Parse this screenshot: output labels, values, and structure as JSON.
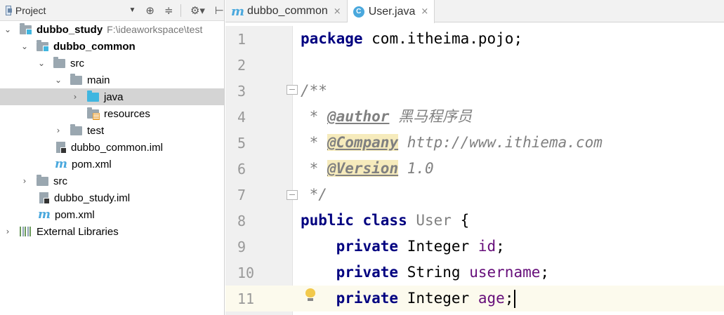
{
  "project_panel": {
    "title": "Project",
    "dropdown": "▼",
    "tools": [
      "⊕",
      "≑",
      "⚙▾",
      "⊢"
    ],
    "tree": [
      {
        "label": "dubbo_study",
        "path": "F:\\ideaworkspace\\test",
        "arrow": "⌄",
        "icon": "module-folder",
        "bold": true
      },
      {
        "label": "dubbo_common",
        "arrow": "⌄",
        "icon": "module-folder",
        "bold": true
      },
      {
        "label": "src",
        "arrow": "⌄",
        "icon": "folder"
      },
      {
        "label": "main",
        "arrow": "⌄",
        "icon": "folder"
      },
      {
        "label": "java",
        "arrow": "›",
        "icon": "source-folder",
        "selected": true
      },
      {
        "label": "resources",
        "arrow": "",
        "icon": "resources-folder"
      },
      {
        "label": "test",
        "arrow": "›",
        "icon": "folder"
      },
      {
        "label": "dubbo_common.iml",
        "arrow": "",
        "icon": "iml-file"
      },
      {
        "label": "pom.xml",
        "arrow": "",
        "icon": "maven-file"
      },
      {
        "label": "src",
        "arrow": "›",
        "icon": "folder"
      },
      {
        "label": "dubbo_study.iml",
        "arrow": "",
        "icon": "iml-file"
      },
      {
        "label": "pom.xml",
        "arrow": "",
        "icon": "maven-file"
      },
      {
        "label": "External Libraries",
        "arrow": "›",
        "icon": "libraries"
      }
    ]
  },
  "editor": {
    "tabs": [
      {
        "label": "dubbo_common",
        "icon": "maven-file",
        "close": "×",
        "active": false
      },
      {
        "label": "User.java",
        "icon": "class-icon",
        "icon_text": "C",
        "close": "×",
        "active": true
      }
    ],
    "maven_letter": "m",
    "line_numbers": [
      "1",
      "2",
      "3",
      "4",
      "5",
      "6",
      "7",
      "8",
      "9",
      "10",
      "11"
    ],
    "code": {
      "l1_kw": "package",
      "l1_rest": " com.itheima.pojo;",
      "l3": "/**",
      "l4_star": " * ",
      "l4_tag": "@author",
      "l4_text": " 黑马程序员",
      "l5_star": " * ",
      "l5_tag": "@Company",
      "l5_text": " http://www.ithiema.com",
      "l6_star": " * ",
      "l6_tag": "@Version",
      "l6_text": " 1.0",
      "l7": " */",
      "l8_kw": "public class",
      "l8_cls": " User",
      "l8_rest": " {",
      "l9_kw": "    private",
      "l9_type": " Integer ",
      "l9_field": "id",
      "l9_end": ";",
      "l10_kw": "    private",
      "l10_type": " String ",
      "l10_field": "username",
      "l10_end": ";",
      "l11_kw": "    private",
      "l11_type": " Integer ",
      "l11_field": "age",
      "l11_end": ";"
    }
  }
}
